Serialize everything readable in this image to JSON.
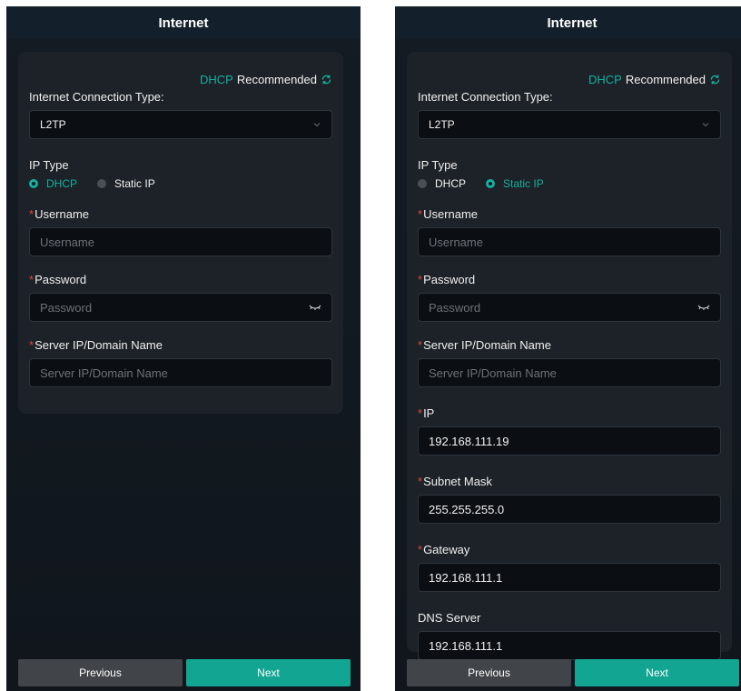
{
  "panels": {
    "left": {
      "title": "Internet",
      "recommend": {
        "highlight": "DHCP",
        "text": "Recommended"
      },
      "connection_type": {
        "label": "Internet Connection Type:",
        "value": "L2TP"
      },
      "ip_type": {
        "label": "IP Type",
        "options": [
          "DHCP",
          "Static IP"
        ],
        "selected": "DHCP"
      },
      "username": {
        "label": "Username",
        "placeholder": "Username"
      },
      "password": {
        "label": "Password",
        "placeholder": "Password"
      },
      "server": {
        "label": "Server IP/Domain Name",
        "placeholder": "Server IP/Domain Name"
      },
      "buttons": {
        "previous": "Previous",
        "next": "Next"
      }
    },
    "right": {
      "title": "Internet",
      "recommend": {
        "highlight": "DHCP",
        "text": "Recommended"
      },
      "connection_type": {
        "label": "Internet Connection Type:",
        "value": "L2TP"
      },
      "ip_type": {
        "label": "IP Type",
        "options": [
          "DHCP",
          "Static IP"
        ],
        "selected": "Static IP"
      },
      "username": {
        "label": "Username",
        "placeholder": "Username"
      },
      "password": {
        "label": "Password",
        "placeholder": "Password"
      },
      "server": {
        "label": "Server IP/Domain Name",
        "placeholder": "Server IP/Domain Name"
      },
      "ip": {
        "label": "IP",
        "value": "192.168.111.19"
      },
      "subnet": {
        "label": "Subnet Mask",
        "value": "255.255.255.0"
      },
      "gateway": {
        "label": "Gateway",
        "value": "192.168.111.1"
      },
      "dns": {
        "label": "DNS Server",
        "value": "192.168.111.1"
      },
      "buttons": {
        "previous": "Previous",
        "next": "Next"
      }
    }
  },
  "icons": {
    "refresh": "refresh-icon",
    "chevron": "chevron-down-icon",
    "eye": "eye-closed-icon"
  },
  "colors": {
    "accent": "#16b09f",
    "required": "#e0463d",
    "background": "#141b23",
    "card": "#1d2228"
  }
}
